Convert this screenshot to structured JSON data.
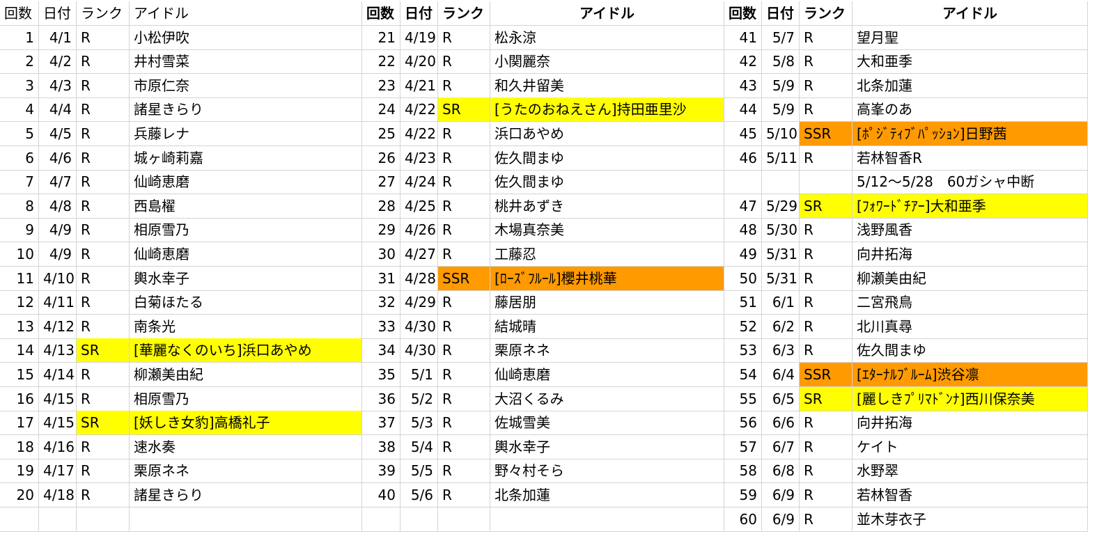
{
  "colors": {
    "sr": "#ffff00",
    "ssr": "#ff9a00",
    "grid": "#d4d4d4"
  },
  "headers": {
    "a": [
      "回数",
      "日付",
      "ランク",
      "アイドル"
    ],
    "b": [
      "回数",
      "日付",
      "ランク",
      "アイドル"
    ],
    "c": [
      "回数",
      "日付",
      "ランク",
      "アイドル"
    ]
  },
  "table_a": [
    [
      "1",
      "4/1",
      "R",
      "小松伊吹"
    ],
    [
      "2",
      "4/2",
      "R",
      "井村雪菜"
    ],
    [
      "3",
      "4/3",
      "R",
      "市原仁奈"
    ],
    [
      "4",
      "4/4",
      "R",
      "諸星きらり"
    ],
    [
      "5",
      "4/5",
      "R",
      "兵藤レナ"
    ],
    [
      "6",
      "4/6",
      "R",
      "城ヶ崎莉嘉"
    ],
    [
      "7",
      "4/7",
      "R",
      "仙崎恵磨"
    ],
    [
      "8",
      "4/8",
      "R",
      "西島櫂"
    ],
    [
      "9",
      "4/9",
      "R",
      "相原雪乃"
    ],
    [
      "10",
      "4/9",
      "R",
      "仙崎恵磨"
    ],
    [
      "11",
      "4/10",
      "R",
      "輿水幸子"
    ],
    [
      "12",
      "4/11",
      "R",
      "白菊ほたる"
    ],
    [
      "13",
      "4/12",
      "R",
      "南条光"
    ],
    [
      "14",
      "4/13",
      "SR",
      "[華麗なくのいち]浜口あやめ"
    ],
    [
      "15",
      "4/14",
      "R",
      "柳瀬美由紀"
    ],
    [
      "16",
      "4/15",
      "R",
      "相原雪乃"
    ],
    [
      "17",
      "4/15",
      "SR",
      "[妖しき女豹]高橋礼子"
    ],
    [
      "18",
      "4/16",
      "R",
      "速水奏"
    ],
    [
      "19",
      "4/17",
      "R",
      "栗原ネネ"
    ],
    [
      "20",
      "4/18",
      "R",
      "諸星きらり"
    ],
    [
      "",
      "",
      "",
      ""
    ]
  ],
  "table_b": [
    [
      "21",
      "4/19",
      "R",
      "松永涼"
    ],
    [
      "22",
      "4/20",
      "R",
      "小関麗奈"
    ],
    [
      "23",
      "4/21",
      "R",
      "和久井留美"
    ],
    [
      "24",
      "4/22",
      "SR",
      "[うたのおねえさん]持田亜里沙"
    ],
    [
      "25",
      "4/22",
      "R",
      "浜口あやめ"
    ],
    [
      "26",
      "4/23",
      "R",
      "佐久間まゆ"
    ],
    [
      "27",
      "4/24",
      "R",
      "佐久間まゆ"
    ],
    [
      "28",
      "4/25",
      "R",
      "桃井あずき"
    ],
    [
      "29",
      "4/26",
      "R",
      "木場真奈美"
    ],
    [
      "30",
      "4/27",
      "R",
      "工藤忍"
    ],
    [
      "31",
      "4/28",
      "SSR",
      "[ﾛｰｽﾞﾌﾙｰﾙ]櫻井桃華"
    ],
    [
      "32",
      "4/29",
      "R",
      "藤居朋"
    ],
    [
      "33",
      "4/30",
      "R",
      "結城晴"
    ],
    [
      "34",
      "4/30",
      "R",
      "栗原ネネ"
    ],
    [
      "35",
      "5/1",
      "R",
      "仙崎恵磨"
    ],
    [
      "36",
      "5/2",
      "R",
      "大沼くるみ"
    ],
    [
      "37",
      "5/3",
      "R",
      "佐城雪美"
    ],
    [
      "38",
      "5/4",
      "R",
      "輿水幸子"
    ],
    [
      "39",
      "5/5",
      "R",
      "野々村そら"
    ],
    [
      "40",
      "5/6",
      "R",
      "北条加蓮"
    ],
    [
      "",
      "",
      "",
      ""
    ]
  ],
  "table_c": [
    [
      "41",
      "5/7",
      "R",
      "望月聖"
    ],
    [
      "42",
      "5/8",
      "R",
      "大和亜季"
    ],
    [
      "43",
      "5/9",
      "R",
      "北条加蓮"
    ],
    [
      "44",
      "5/9",
      "R",
      "高峯のあ"
    ],
    [
      "45",
      "5/10",
      "SSR",
      "[ﾎﾟｼﾞﾃｨﾌﾞﾊﾟｯｼｮﾝ]日野茜"
    ],
    [
      "46",
      "5/11",
      "R",
      "若林智香R"
    ],
    [
      "",
      "",
      "",
      "5/12〜5/28　60ガシャ中断"
    ],
    [
      "47",
      "5/29",
      "SR",
      "[ﾌｫﾜｰﾄﾞﾁｱｰ]大和亜季"
    ],
    [
      "48",
      "5/30",
      "R",
      "浅野風香"
    ],
    [
      "49",
      "5/31",
      "R",
      "向井拓海"
    ],
    [
      "50",
      "5/31",
      "R",
      "柳瀬美由紀"
    ],
    [
      "51",
      "6/1",
      "R",
      "二宮飛鳥"
    ],
    [
      "52",
      "6/2",
      "R",
      "北川真尋"
    ],
    [
      "53",
      "6/3",
      "R",
      "佐久間まゆ"
    ],
    [
      "54",
      "6/4",
      "SSR",
      "[ｴﾀｰﾅﾙﾌﾞﾙｰﾑ]渋谷凛"
    ],
    [
      "55",
      "6/5",
      "SR",
      "[麗しきﾌﾟﾘﾏﾄﾞﾝﾅ]西川保奈美"
    ],
    [
      "56",
      "6/6",
      "R",
      "向井拓海"
    ],
    [
      "57",
      "6/7",
      "R",
      "ケイト"
    ],
    [
      "58",
      "6/8",
      "R",
      "水野翠"
    ],
    [
      "59",
      "6/9",
      "R",
      "若林智香"
    ],
    [
      "60",
      "6/9",
      "R",
      "並木芽衣子"
    ]
  ]
}
